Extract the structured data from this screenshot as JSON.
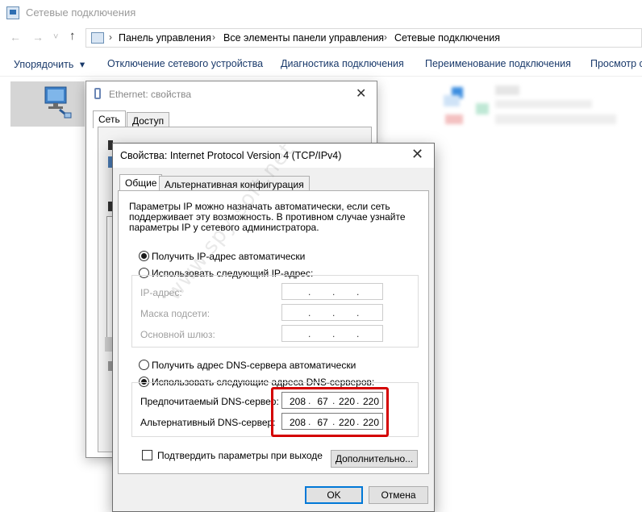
{
  "window": {
    "title": "Сетевые подключения"
  },
  "address": {
    "back_arrow": "←",
    "forward_arrow": "→",
    "dropdown": "˅",
    "up_arrow": "↑",
    "breadcrumbs": [
      "Панель управления",
      "Все элементы панели управления",
      "Сетевые подключения"
    ],
    "separator": "›"
  },
  "toolbar": {
    "items": [
      "Упорядочить",
      "Отключение сетевого устройства",
      "Диагностика подключения",
      "Переименование подключения",
      "Просмотр с"
    ],
    "organize_arrow": "▾"
  },
  "ethernet": {
    "title": "Ethernet: свойства",
    "close": "✕",
    "tabs": [
      "Сеть",
      "Доступ"
    ]
  },
  "ipv4": {
    "title": "Свойства: Internet Protocol Version 4 (TCP/IPv4)",
    "close": "✕",
    "tabs": [
      "Общие",
      "Альтернативная конфигурация"
    ],
    "description": [
      "Параметры IP можно назначать автоматически, если сеть",
      "поддерживает эту возможность. В противном случае узнайте",
      "параметры IP у сетевого администратора."
    ],
    "ip_auto_label": "Получить IP-адрес автоматически",
    "ip_manual_label": "Использовать следующий IP-адрес:",
    "ip_auto_selected": true,
    "ip_fields": [
      {
        "label": "IP-адрес:",
        "value": [
          " ",
          " ",
          " ",
          " "
        ]
      },
      {
        "label": "Маска подсети:",
        "value": [
          " ",
          " ",
          " ",
          " "
        ]
      },
      {
        "label": "Основной шлюз:",
        "value": [
          " ",
          " ",
          " ",
          " "
        ]
      }
    ],
    "dns_auto_label": "Получить адрес DNS-сервера автоматически",
    "dns_manual_label": "Использовать следующие адреса DNS-серверов:",
    "dns_manual_selected": true,
    "dns_fields": [
      {
        "label": "Предпочитаемый DNS-сервер:",
        "octets": [
          "208",
          "67",
          "220",
          "220"
        ]
      },
      {
        "label": "Альтернативный DNS-сервер:",
        "octets": [
          "208",
          "67",
          "220",
          "220"
        ]
      }
    ],
    "validate_label": "Подтвердить параметры при выходе",
    "advanced_button": "Дополнительно...",
    "ok_button": "OK",
    "cancel_button": "Отмена"
  },
  "watermark": "www.spy-soft.net",
  "colors": {
    "highlight": "#d40000",
    "accent": "#0078d7",
    "toolbar_text": "#1a3a6b"
  }
}
